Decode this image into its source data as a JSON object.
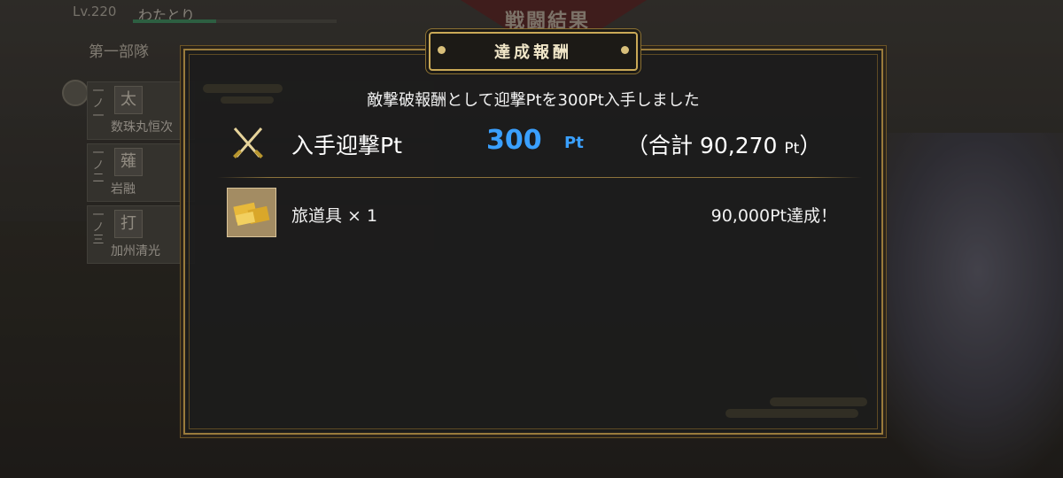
{
  "background": {
    "result_title": "戦闘結果",
    "player_level": "Lv.220",
    "player_name": "わたとり",
    "squad_label": "第一部隊",
    "slots": [
      {
        "index": "一ノ一",
        "type": "太",
        "name": "数珠丸恒次"
      },
      {
        "index": "一ノ二",
        "type": "薙",
        "name": "岩融"
      },
      {
        "index": "一ノ三",
        "type": "打",
        "name": "加州清光"
      }
    ]
  },
  "modal": {
    "title": "達成報酬",
    "message": "敵撃破報酬として迎撃Ptを300Pt入手しました",
    "earn_label": "入手迎撃Pt",
    "earn_value": "300",
    "earn_unit": "Pt",
    "total_prefix": "（合計 90,270",
    "total_unit": "Pt",
    "total_suffix": "）",
    "reward_item": "旅道具 × 1",
    "reward_note": "90,000Pt達成！"
  },
  "colors": {
    "accent_gold": "#caa957",
    "points_blue": "#3aa0ff"
  }
}
